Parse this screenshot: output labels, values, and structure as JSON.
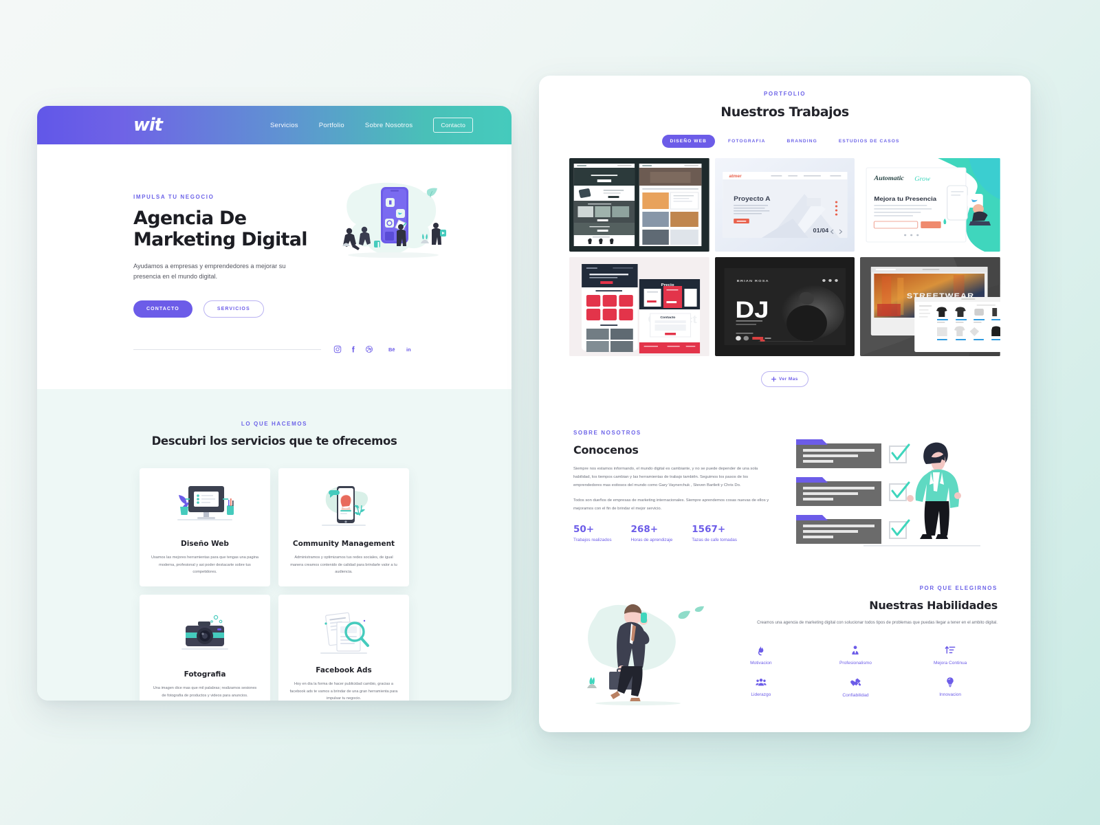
{
  "brand": {
    "logo": "wit",
    "accent": "#6c5ce8",
    "teal": "#45cbbd"
  },
  "nav": {
    "links": [
      {
        "label": "Servicios"
      },
      {
        "label": "Portfolio"
      },
      {
        "label": "Sobre Nosotros"
      }
    ],
    "cta": "Contacto"
  },
  "hero": {
    "eyebrow": "IMPULSA TU NEGOCIO",
    "title": "Agencia De Marketing Digital",
    "subtitle": "Ayudamos a empresas y emprendedores a mejorar su presencia en el mundo digital.",
    "btn_primary": "CONTACTO",
    "btn_secondary": "SERVICIOS",
    "socials": [
      "instagram-icon",
      "facebook-icon",
      "dribbble-icon",
      "behance-icon",
      "linkedin-icon"
    ]
  },
  "services": {
    "eyebrow": "LO QUE HACEMOS",
    "title": "Descubri los servicios que te ofrecemos",
    "cards": [
      {
        "icon": "desktop-monitor-icon",
        "title": "Diseño Web",
        "desc": "Usamos las mejores herramientas para que tengas una pagina moderna, profesional y asi poder destacarte sobre tus competidores."
      },
      {
        "icon": "mobile-chat-icon",
        "title": "Community Management",
        "desc": "Administramos y optimizamos tus redes sociales, de igual manera creamos contenido de calidad para brindarle valor a tu audiencia."
      },
      {
        "icon": "camera-icon",
        "title": "Fotografia",
        "desc": "Una imagen dice mas que mil palabras; realizamos sesiones de fotografia de productos y videos para anuncios."
      },
      {
        "icon": "ad-search-icon",
        "title": "Facebook Ads",
        "desc": "Hoy en dia la forma de hacer publicidad cambio, gracias a facebook ads te vamos a brindar de una gran herramienta para impulsar tu negocio."
      }
    ]
  },
  "portfolio": {
    "eyebrow": "PORTFOLIO",
    "title": "Nuestros Trabajos",
    "filters": [
      {
        "label": "DISEÑO WEB",
        "active": true
      },
      {
        "label": "FOTOGRAFIA",
        "active": false
      },
      {
        "label": "BRANDING",
        "active": false
      },
      {
        "label": "ESTUDIOS DE CASOS",
        "active": false
      }
    ],
    "items": [
      {
        "name": "forest-ecommerce-mockup",
        "caption": ""
      },
      {
        "name": "proyecto-a-architecture-site",
        "caption": "Proyecto A",
        "counter": "01/04"
      },
      {
        "name": "automatic-grow-landing",
        "caption": "Mejora tu Presencia",
        "logo": "Automatic Grow"
      },
      {
        "name": "red-events-mobile-app",
        "caption": "Contacto"
      },
      {
        "name": "dj-brian-rosa-site",
        "caption": "DJ"
      },
      {
        "name": "streetwear-store-site",
        "caption": "STREETWEAR"
      }
    ],
    "more_button": "Ver Mas",
    "more_icon": "plus-icon"
  },
  "about": {
    "eyebrow": "SOBRE NOSOTROS",
    "title": "Conocenos",
    "paragraphs": [
      "Siempre nos estamos informando, el mundo digital es cambiante, y no se puede depender de una sola habilidad, los tiempos cambian y las herramientas de trabajo tambiên. Seguimos los pasos de los emprendedores mas exitosos del mundo como Gary Vaynerchuk , Steven Bartlett y Chris Do.",
      "Todos son dueños de empresas de marketing internacionales. Siempre aprendemos cosas nuevas de ellos y mejoramos  con el fin de brindar el mejor servicio."
    ],
    "stats": [
      {
        "value": "50+",
        "label": "Trabajos realizados"
      },
      {
        "value": "268+",
        "label": "Horas de aprendizaje"
      },
      {
        "value": "1567+",
        "label": "Tazas de cafe tomadas"
      }
    ],
    "illustration": "person-with-checklist-illustration"
  },
  "skills": {
    "eyebrow": "POR QUE ELEGIRNOS",
    "title": "Nuestras Habilidades",
    "desc": "Creamos una agencia de marketing digital con solucionar todos tipos de problemas que puedas llegar a tener en el ambito digital.",
    "illustration": "businessman-on-phone-illustration",
    "items": [
      {
        "icon": "fire-icon",
        "label": "Motivacion"
      },
      {
        "icon": "tie-person-icon",
        "label": "Profesionalismo"
      },
      {
        "icon": "sort-up-icon",
        "label": "Mejora Continua"
      },
      {
        "icon": "group-icon",
        "label": "Liderazgo"
      },
      {
        "icon": "handshake-icon",
        "label": "Confiabilidad"
      },
      {
        "icon": "lightbulb-icon",
        "label": "Innovacion"
      }
    ]
  }
}
